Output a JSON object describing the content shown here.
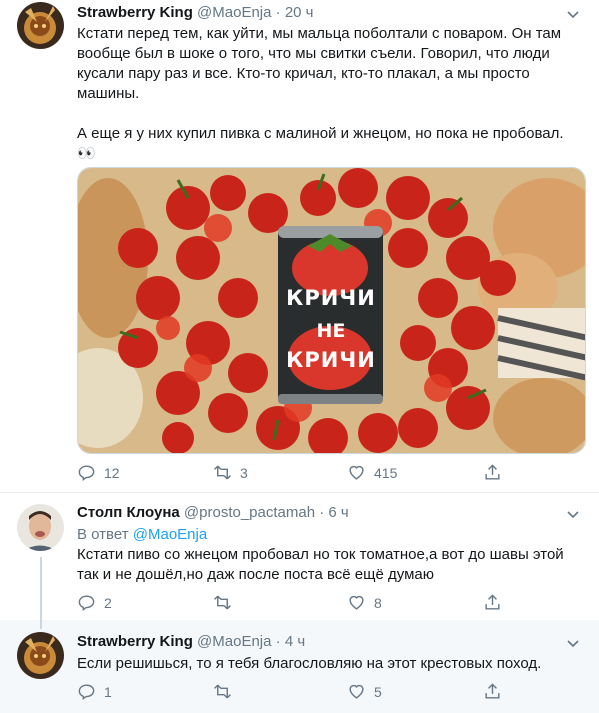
{
  "tweet1": {
    "name": "Strawberry King",
    "handle": "@MaoEnja",
    "dot": "·",
    "time": "20 ч",
    "text": "Кстати перед тем, как уйти, мы мальца поболтали с поваром. Он там вообще был в шоке о того, что мы свитки съели. Говорил, что люди кусали пару раз и все. Кто-то кричал, кто-то плакал, а мы просто машины.\n\nА еще я у них купил пивка с малиной и жнецом, но пока не пробовал. 👀",
    "can_label_1": "КРИЧИ",
    "can_label_2": "НЕ",
    "can_label_3": "КРИЧИ",
    "replies": "12",
    "retweets": "3",
    "likes": "415"
  },
  "tweet2": {
    "name": "Столп Клоуна",
    "handle": "@prosto_pactamah",
    "dot": "·",
    "time": "6 ч",
    "reply_prefix": "В ответ",
    "reply_handle": "@MaoEnja",
    "text": "Кстати пиво со жнецом пробовал но ток томатное,а вот до шавы этой так и не дошёл,но даж после поста всё ещё думаю",
    "replies": "2",
    "retweets": "",
    "likes": "8"
  },
  "tweet3": {
    "name": "Strawberry King",
    "handle": "@MaoEnja",
    "dot": "·",
    "time": "4 ч",
    "text": "Если решишься, то я тебя благословляю на этот крестовых поход.",
    "replies": "1",
    "retweets": "",
    "likes": "5"
  },
  "colors": {
    "muted": "#657786",
    "link": "#1da1f2",
    "separator": "#e6ecf0"
  }
}
